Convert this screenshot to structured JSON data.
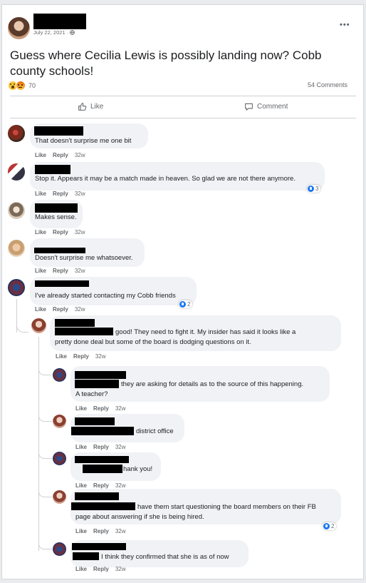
{
  "post": {
    "date": "July 22, 2021 · ",
    "globe_icon": "globe-icon",
    "more_icon": "more-options-icon",
    "text": "Guess where Cecilia Lewis is possibly landing now? Cobb county schools!",
    "reaction_count": "70",
    "reaction_icons": [
      "wow-emoji-icon",
      "angry-emoji-icon"
    ],
    "comments_count": "54 Comments",
    "like_label": "Like",
    "comment_label": "Comment"
  },
  "comments": [
    {
      "text": "That doesn't surprise me one bit",
      "like": "Like",
      "reply": "Reply",
      "time": "32w"
    },
    {
      "text": "Stop it. Appears it may be a match made in heaven. So glad we are not there anymore.",
      "like": "Like",
      "reply": "Reply",
      "time": "32w",
      "reactions": "3"
    },
    {
      "text": "Makes sense.",
      "like": "Like",
      "reply": "Reply",
      "time": "32w"
    },
    {
      "text": "Doesn't surprise me whatsoever.",
      "like": "Like",
      "reply": "Reply",
      "time": "32w"
    },
    {
      "text": "I've already started contacting my Cobb friends",
      "like": "Like",
      "reply": "Reply",
      "time": "32w",
      "reactions": "2"
    }
  ],
  "replies": [
    {
      "line1": "good! They need to fight it. My insider has said it looks like a",
      "line2": "pretty done deal but some of the board is dodging questions on it.",
      "like": "Like",
      "reply": "Reply",
      "time": "32w"
    },
    {
      "line1": "they are asking for details as to the source of this happening.",
      "line2": "A teacher?",
      "like": "Like",
      "reply": "Reply",
      "time": "32w"
    },
    {
      "line1": "district office",
      "like": "Like",
      "reply": "Reply",
      "time": "32w"
    },
    {
      "line1": "hank you!",
      "like": "Like",
      "reply": "Reply",
      "time": "32w"
    },
    {
      "line1": "have them start questioning the board members on their FB",
      "line2": "page about answering if she is being hired.",
      "like": "Like",
      "reply": "Reply",
      "time": "32w",
      "reactions": "2"
    },
    {
      "line1": "I think they confirmed that she is as of now",
      "like": "Like",
      "reply": "Reply",
      "time": "32w"
    }
  ]
}
